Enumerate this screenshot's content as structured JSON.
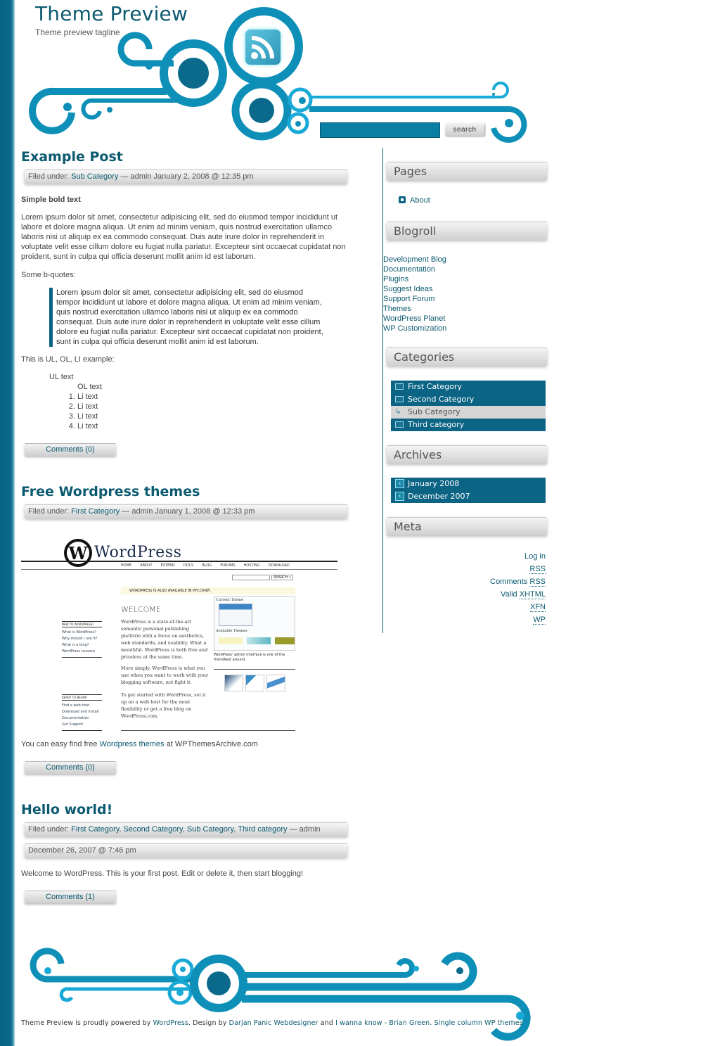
{
  "site": {
    "title": "Theme Preview",
    "tagline": "Theme preview tagline",
    "colors": {
      "brand": "#0b5a70",
      "accent": "#0b6484",
      "swirl": "#0e8fb8"
    }
  },
  "search": {
    "value": "",
    "button_label": "search"
  },
  "posts": [
    {
      "title": "Example Post",
      "filed_label": "Filed under:",
      "categories": [
        "Sub Category"
      ],
      "meta_suffix": "— admin January 2, 2008 @ 12:35 pm",
      "bold_text": "Simple bold text",
      "paragraph": "Lorem ipsum dolor sit amet, consectetur adipisicing elit, sed do eiusmod tempor incididunt ut labore et dolore magna aliqua. Ut enim ad minim veniam, quis nostrud exercitation ullamco laboris nisi ut aliquip ex ea commodo consequat. Duis aute irure dolor in reprehenderit in voluptate velit esse cillum dolore eu fugiat nulla pariatur. Excepteur sint occaecat cupidatat non proident, sunt in culpa qui officia deserunt mollit anim id est laborum.",
      "bquote_label": "Some b-quotes:",
      "blockquote": "Lorem ipsum dolor sit amet, consectetur adipisicing elit, sed do eiusmod tempor incididunt ut labore et dolore magna aliqua. Ut enim ad minim veniam, quis nostrud exercitation ullamco laboris nisi ut aliquip ex ea commodo consequat. Duis aute irure dolor in reprehenderit in voluptate velit esse cillum dolore eu fugiat nulla pariatur. Excepteur sint occaecat cupidatat non proident, sunt in culpa qui officia deserunt mollit anim id est laborum.",
      "list_label": "This is UL, OL, LI example:",
      "ul_text": "UL text",
      "ol_text": "OL text",
      "li_items": [
        "Li text",
        "Li text",
        "Li text",
        "Li text"
      ],
      "comments_label": "Comments (0)"
    },
    {
      "title": "Free Wordpress themes",
      "filed_label": "Filed under:",
      "categories": [
        "First Category"
      ],
      "meta_suffix": "— admin January 1, 2008 @ 12:33 pm",
      "text_before": "You can easy find free",
      "link_text": "Wordpress themes",
      "text_after": "at WPThemesArchive.com",
      "comments_label": "Comments (0)",
      "screenshot": {
        "logo_text": "WordPress",
        "nav": [
          "HOME",
          "ABOUT",
          "EXTEND",
          "DOCS",
          "BLOG",
          "FORUMS",
          "HOSTING",
          "DOWNLOAD"
        ],
        "search_button": "SEARCH »",
        "notice": "WORDPRESS IS ALSO AVAILABLE IN РУССКИЙ.",
        "welcome": "WELCOME",
        "new_heading": "NEW TO WORDPRESS?",
        "new_links": [
          "What is WordPress?",
          "Why should I use it?",
          "What is a blog?",
          "WordPress Lessons"
        ],
        "ready_heading": "READY TO BEGIN?",
        "ready_links": [
          "Find a web host",
          "Download and Install",
          "Documentation",
          "Get Support"
        ],
        "p1": "WordPress is a state-of-the-art semantic personal publishing platform with a focus on aesthetics, web standards, and usability. What a mouthful. WordPress is both free and priceless at the same time.",
        "p2": "More simply, WordPress is what you use when you want to work with your blogging software, not fight it.",
        "p3": "To get started with WordPress, set it up on a web host for the most flexibility or get a free blog on WordPress.com.",
        "current_theme": "Current Theme",
        "available_themes": "Available Themes",
        "caption": "WordPress' admin interface is one of the friendliest around."
      }
    },
    {
      "title": "Hello world!",
      "filed_label": "Filed under:",
      "categories": [
        "First Category",
        "Second Category",
        "Sub Category",
        "Third category"
      ],
      "meta_suffix": "— admin",
      "date": "December 26, 2007 @ 7:46 pm",
      "paragraph": "Welcome to WordPress. This is your first post. Edit or delete it, then start blogging!",
      "comments_label": "Comments (1)"
    }
  ],
  "sidebar": {
    "pages": {
      "title": "Pages",
      "items": [
        "About"
      ]
    },
    "blogroll": {
      "title": "Blogroll",
      "items": [
        "Development Blog",
        "Documentation",
        "Plugins",
        "Suggest Ideas",
        "Support Forum",
        "Themes",
        "WordPress Planet",
        "WP Customization"
      ]
    },
    "categories": {
      "title": "Categories",
      "items": [
        {
          "label": "First Category",
          "sub": false
        },
        {
          "label": "Second Category",
          "sub": false
        },
        {
          "label": "Sub Category",
          "sub": true
        },
        {
          "label": "Third category",
          "sub": false
        }
      ]
    },
    "archives": {
      "title": "Archives",
      "items": [
        "January 2008",
        "December 2007"
      ]
    },
    "meta": {
      "title": "Meta",
      "items": [
        {
          "pre": "Log in",
          "link": ""
        },
        {
          "pre": "",
          "link": "RSS"
        },
        {
          "pre": "Comments ",
          "link": "RSS"
        },
        {
          "pre": "Valid ",
          "link": "XHTML"
        },
        {
          "pre": "",
          "link": "XFN"
        },
        {
          "pre": "",
          "link": "WP"
        }
      ]
    }
  },
  "footer": {
    "t1": "Theme Preview is proudly powered by",
    "l1": "WordPress",
    "t2": ". Design by",
    "l2": "Darjan Panic Webdesigner",
    "t3": "and",
    "l3": "I wanna know - Brian Green",
    "t4": ".",
    "l4": "Single column WP themes"
  }
}
